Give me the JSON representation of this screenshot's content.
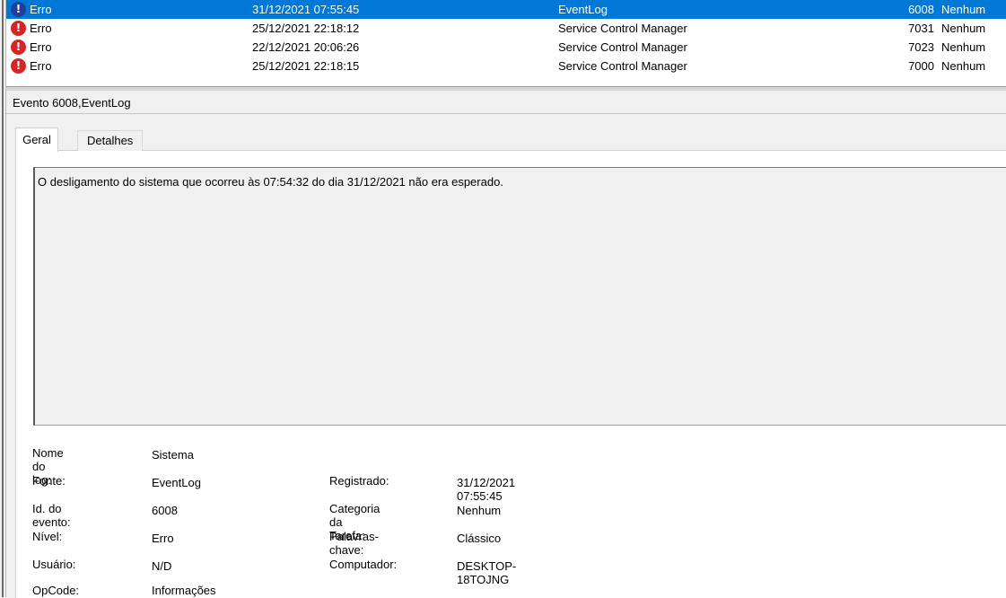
{
  "event_list": {
    "rows": [
      {
        "level": "Erro",
        "date": "31/12/2021 07:55:45",
        "source": "EventLog",
        "event_id": "6008",
        "category": "Nenhum",
        "selected": true,
        "icon": "error-icon"
      },
      {
        "level": "Erro",
        "date": "25/12/2021 22:18:12",
        "source": "Service Control Manager",
        "event_id": "7031",
        "category": "Nenhum",
        "selected": false,
        "icon": "error-icon"
      },
      {
        "level": "Erro",
        "date": "22/12/2021 20:06:26",
        "source": "Service Control Manager",
        "event_id": "7023",
        "category": "Nenhum",
        "selected": false,
        "icon": "error-icon"
      },
      {
        "level": "Erro",
        "date": "25/12/2021 22:18:15",
        "source": "Service Control Manager",
        "event_id": "7000",
        "category": "Nenhum",
        "selected": false,
        "icon": "error-icon"
      }
    ]
  },
  "detail": {
    "title": "Evento 6008,EventLog",
    "tabs": [
      {
        "label": "Geral",
        "active": true
      },
      {
        "label": "Detalhes",
        "active": false
      }
    ],
    "message": "O desligamento do sistema que ocorreu às 07:54:32 do dia 31/12/2021 não era esperado.",
    "properties": {
      "log_name_label": "Nome do log:",
      "log_name": "Sistema",
      "source_label": "Fonte:",
      "source": "EventLog",
      "event_id_label": "Id. do evento:",
      "event_id": "6008",
      "level_label": "Nível:",
      "level": "Erro",
      "user_label": "Usuário:",
      "user": "N/D",
      "opcode_label": "OpCode:",
      "opcode": "Informações",
      "logged_label": "Registrado:",
      "logged": "31/12/2021 07:55:45",
      "task_category_label": "Categoria da Tarefa:",
      "task_category": "Nenhum",
      "keywords_label": "Palavras-chave:",
      "keywords": "Clássico",
      "computer_label": "Computador:",
      "computer": "DESKTOP-18TOJNG"
    }
  },
  "colors": {
    "selection": "#0078d7",
    "error": "#d32626"
  }
}
